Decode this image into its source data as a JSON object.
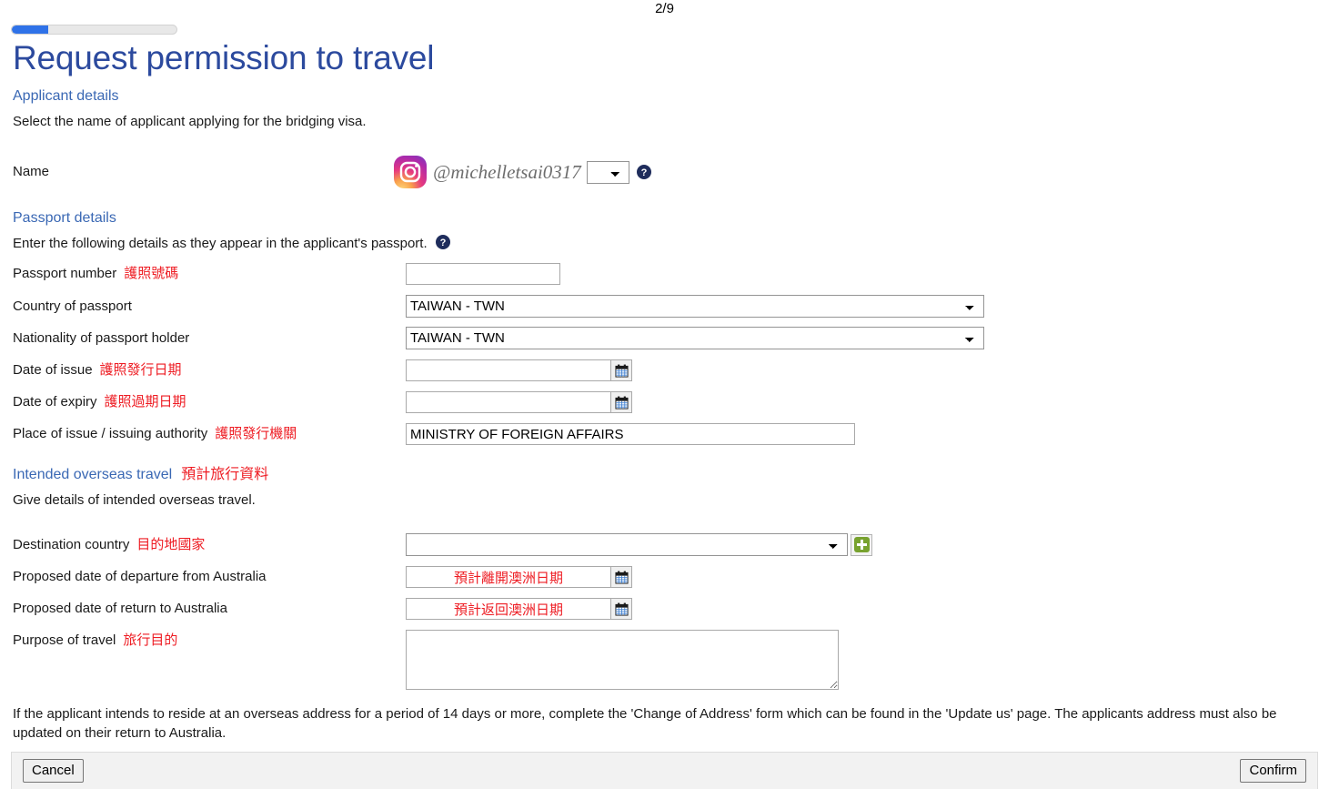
{
  "header": {
    "step_counter": "2/9",
    "progress_percent": 22,
    "progress_color": "#2f72e8",
    "page_title": "Request permission to travel"
  },
  "applicant_section": {
    "heading": "Applicant details",
    "description": "Select the name of applicant applying for the bridging visa.",
    "name_label": "Name",
    "instagram_handle": "@michelletsai0317",
    "name_select_value": "",
    "help_icon": "help-circle-icon"
  },
  "passport_section": {
    "heading": "Passport details",
    "description": "Enter the following details as they appear in the applicant's passport.",
    "fields": {
      "passport_number": {
        "label": "Passport number",
        "label_cn": "護照號碼",
        "value": ""
      },
      "country_of_passport": {
        "label": "Country of passport",
        "value": "TAIWAN - TWN"
      },
      "nationality": {
        "label": "Nationality of passport holder",
        "value": "TAIWAN - TWN"
      },
      "date_of_issue": {
        "label": "Date of issue",
        "label_cn": "護照發行日期",
        "value": ""
      },
      "date_of_expiry": {
        "label": "Date of expiry",
        "label_cn": "護照過期日期",
        "value": ""
      },
      "place_of_issue": {
        "label": "Place of issue / issuing authority",
        "label_cn": "護照發行機關",
        "value": "MINISTRY OF FOREIGN AFFAIRS"
      }
    }
  },
  "travel_section": {
    "heading": "Intended overseas travel",
    "heading_cn": "預計旅行資料",
    "description": "Give details of intended overseas travel.",
    "fields": {
      "destination_country": {
        "label": "Destination country",
        "label_cn": "目的地國家",
        "value": ""
      },
      "departure_date": {
        "label": "Proposed date of departure from Australia",
        "value_cn": "預計離開澳洲日期"
      },
      "return_date": {
        "label": "Proposed date of return to Australia",
        "value_cn": "預計返回澳洲日期"
      },
      "purpose_of_travel": {
        "label": "Purpose of travel",
        "label_cn": "旅行目的",
        "value": ""
      }
    },
    "add_button_icon": "plus-icon"
  },
  "footer_note": "If the applicant intends to reside at an overseas address for a period of 14 days or more, complete the 'Change of Address' form which can be found in the 'Update us' page. The applicants address must also be updated on their return to Australia.",
  "actions": {
    "cancel_label": "Cancel",
    "confirm_label": "Confirm"
  },
  "colors": {
    "title_blue": "#2c4a9e",
    "section_blue": "#3a68b4",
    "annotation_red": "#ee1c23",
    "progress_blue": "#2f72e8",
    "add_green": "#78a22f"
  }
}
